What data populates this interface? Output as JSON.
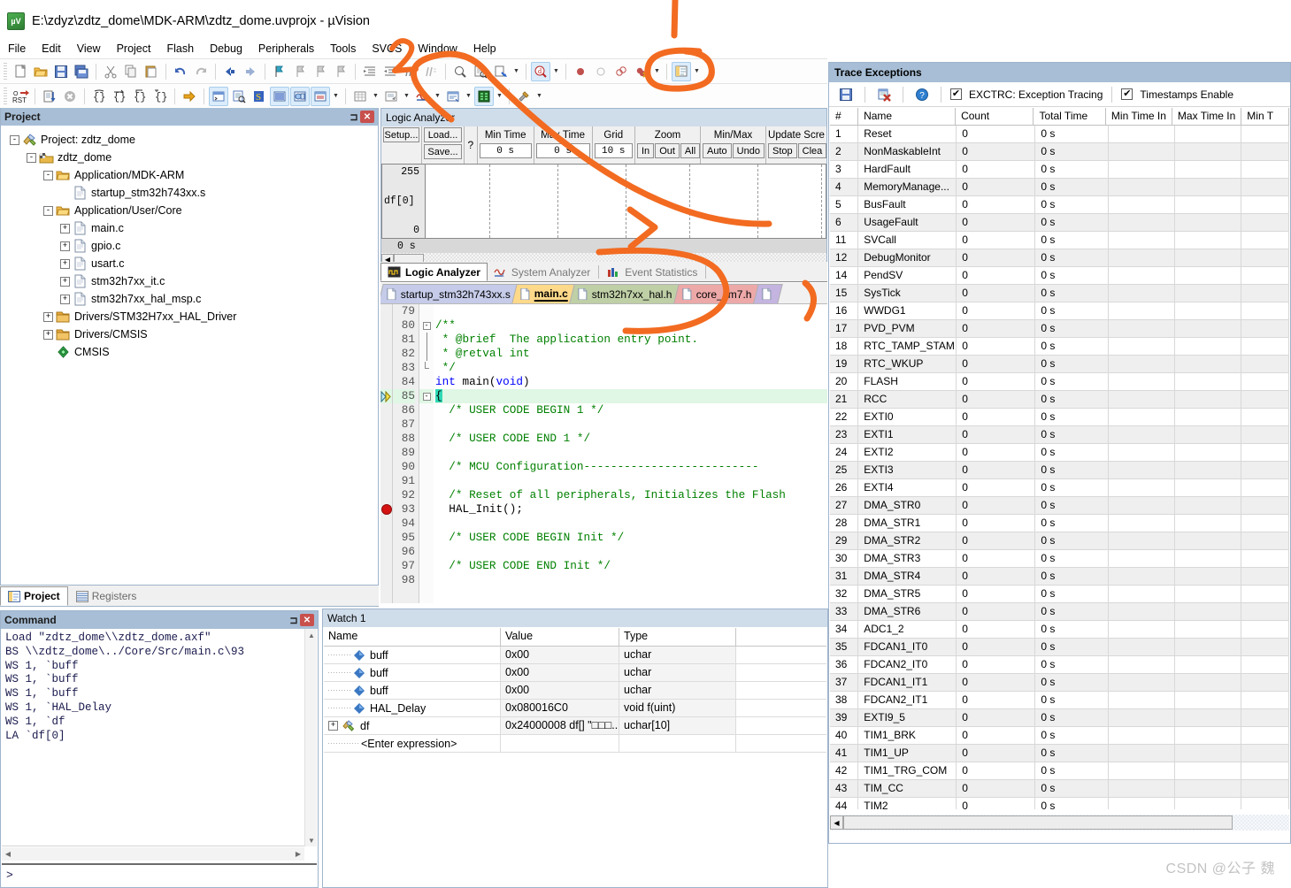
{
  "window": {
    "title": "E:\\zdyz\\zdtz_dome\\MDK-ARM\\zdtz_dome.uvprojx - µVision",
    "app_icon": "uvision-icon"
  },
  "menu": [
    "File",
    "Edit",
    "View",
    "Project",
    "Flash",
    "Debug",
    "Peripherals",
    "Tools",
    "SVCS",
    "Window",
    "Help"
  ],
  "project": {
    "panel_title": "Project",
    "tree": [
      {
        "indent": 0,
        "toggle": "-",
        "icon": "project-icon",
        "label": "Project: zdtz_dome"
      },
      {
        "indent": 1,
        "toggle": "-",
        "icon": "target-icon",
        "label": "zdtz_dome"
      },
      {
        "indent": 2,
        "toggle": "-",
        "icon": "folder-open-icon",
        "label": "Application/MDK-ARM"
      },
      {
        "indent": 3,
        "toggle": "",
        "icon": "file-icon",
        "label": "startup_stm32h743xx.s"
      },
      {
        "indent": 2,
        "toggle": "-",
        "icon": "folder-open-icon",
        "label": "Application/User/Core"
      },
      {
        "indent": 3,
        "toggle": "+",
        "icon": "file-icon",
        "label": "main.c"
      },
      {
        "indent": 3,
        "toggle": "+",
        "icon": "file-icon",
        "label": "gpio.c"
      },
      {
        "indent": 3,
        "toggle": "+",
        "icon": "file-icon",
        "label": "usart.c"
      },
      {
        "indent": 3,
        "toggle": "+",
        "icon": "file-icon",
        "label": "stm32h7xx_it.c"
      },
      {
        "indent": 3,
        "toggle": "+",
        "icon": "file-icon",
        "label": "stm32h7xx_hal_msp.c"
      },
      {
        "indent": 2,
        "toggle": "+",
        "icon": "folder-icon",
        "label": "Drivers/STM32H7xx_HAL_Driver"
      },
      {
        "indent": 2,
        "toggle": "+",
        "icon": "folder-icon",
        "label": "Drivers/CMSIS"
      },
      {
        "indent": 2,
        "toggle": "",
        "icon": "cmsis-icon",
        "label": "CMSIS"
      }
    ],
    "bottom_tabs": [
      {
        "label": "Project",
        "icon": "project-tab-icon",
        "active": true
      },
      {
        "label": "Registers",
        "icon": "registers-tab-icon",
        "active": false
      }
    ]
  },
  "command": {
    "panel_title": "Command",
    "log": "Load \"zdtz_dome\\\\zdtz_dome.axf\"\nBS \\\\zdtz_dome\\../Core/Src/main.c\\93\nWS 1, `buff\nWS 1, `buff\nWS 1, `buff\nWS 1, `HAL_Delay\nWS 1, `df\nLA `df[0]",
    "prompt": ">"
  },
  "logic_analyzer": {
    "panel_title": "Logic Analyzer",
    "buttons": {
      "setup": "Setup...",
      "load": "Load...",
      "save": "Save...",
      "help": "?"
    },
    "fields": [
      {
        "label": "Min Time",
        "value": "0 s"
      },
      {
        "label": "Max Time",
        "value": "0 s"
      },
      {
        "label": "Grid",
        "value": "10 s"
      }
    ],
    "groups": [
      {
        "label": "Zoom",
        "buttons": [
          "In",
          "Out",
          "All"
        ]
      },
      {
        "label": "Min/Max",
        "buttons": [
          "Auto",
          "Undo"
        ]
      },
      {
        "label": "Update Scre",
        "buttons": [
          "Stop",
          "Clea"
        ]
      }
    ],
    "signal": {
      "name": "df[0]",
      "max": "255",
      "min": "0"
    },
    "time_label": "0 s",
    "tabs": [
      {
        "label": "Logic Analyzer",
        "icon": "logic-analyzer-icon",
        "active": true
      },
      {
        "label": "System Analyzer",
        "icon": "system-analyzer-icon",
        "active": false
      },
      {
        "label": "Event Statistics",
        "icon": "event-statistics-icon",
        "active": false
      }
    ]
  },
  "editor": {
    "tabs": [
      {
        "label": "startup_stm32h743xx.s",
        "color": "#c5cbe8",
        "active": false
      },
      {
        "label": "main.c",
        "color": "#ffd98a",
        "active": true
      },
      {
        "label": "stm32h7xx_hal.h",
        "color": "#bfcfa6",
        "active": false
      },
      {
        "label": "core_cm7.h",
        "color": "#eda8a8",
        "active": false
      },
      {
        "label": "",
        "color": "#c4b4e0",
        "active": false
      }
    ],
    "lines": [
      {
        "num": "79",
        "text": "",
        "kind": "plain",
        "fold": "",
        "mark": "",
        "hl": false
      },
      {
        "num": "80",
        "text": "/**",
        "kind": "cmt",
        "fold": "-",
        "mark": "",
        "hl": false
      },
      {
        "num": "81",
        "text": " * @brief  The application entry point.",
        "kind": "cmt",
        "fold": "|",
        "mark": "",
        "hl": false
      },
      {
        "num": "82",
        "text": " * @retval int",
        "kind": "cmt",
        "fold": "|",
        "mark": "",
        "hl": false
      },
      {
        "num": "83",
        "text": " */",
        "kind": "cmt",
        "fold": "L",
        "mark": "",
        "hl": false
      },
      {
        "num": "84",
        "text": "int main(void)",
        "kind": "sig",
        "fold": "",
        "mark": "",
        "hl": false
      },
      {
        "num": "85",
        "text": "{",
        "kind": "plain",
        "fold": "-",
        "mark": "arrow",
        "hl": true
      },
      {
        "num": "86",
        "text": "  /* USER CODE BEGIN 1 */",
        "kind": "cmt",
        "fold": "",
        "mark": "",
        "hl": false
      },
      {
        "num": "87",
        "text": "",
        "kind": "plain",
        "fold": "",
        "mark": "",
        "hl": false
      },
      {
        "num": "88",
        "text": "  /* USER CODE END 1 */",
        "kind": "cmt",
        "fold": "",
        "mark": "",
        "hl": false
      },
      {
        "num": "89",
        "text": "",
        "kind": "plain",
        "fold": "",
        "mark": "",
        "hl": false
      },
      {
        "num": "90",
        "text": "  /* MCU Configuration--------------------------",
        "kind": "cmt",
        "fold": "",
        "mark": "",
        "hl": false
      },
      {
        "num": "91",
        "text": "",
        "kind": "plain",
        "fold": "",
        "mark": "",
        "hl": false
      },
      {
        "num": "92",
        "text": "  /* Reset of all peripherals, Initializes the Flash",
        "kind": "cmt",
        "fold": "",
        "mark": "",
        "hl": false
      },
      {
        "num": "93",
        "text": "  HAL_Init();",
        "kind": "plain",
        "fold": "",
        "mark": "bp",
        "hl": false
      },
      {
        "num": "94",
        "text": "",
        "kind": "plain",
        "fold": "",
        "mark": "",
        "hl": false
      },
      {
        "num": "95",
        "text": "  /* USER CODE BEGIN Init */",
        "kind": "cmt",
        "fold": "",
        "mark": "",
        "hl": false
      },
      {
        "num": "96",
        "text": "",
        "kind": "plain",
        "fold": "",
        "mark": "",
        "hl": false
      },
      {
        "num": "97",
        "text": "  /* USER CODE END Init */",
        "kind": "cmt",
        "fold": "",
        "mark": "",
        "hl": false
      },
      {
        "num": "98",
        "text": "",
        "kind": "plain",
        "fold": "",
        "mark": "",
        "hl": false
      }
    ]
  },
  "watch": {
    "panel_title": "Watch 1",
    "columns": [
      "Name",
      "Value",
      "Type"
    ],
    "rows": [
      {
        "name": "buff",
        "value": "0x00",
        "type": "uchar",
        "icon": "variable-icon",
        "expandable": false
      },
      {
        "name": "buff",
        "value": "0x00",
        "type": "uchar",
        "icon": "variable-icon",
        "expandable": false
      },
      {
        "name": "buff",
        "value": "0x00",
        "type": "uchar",
        "icon": "variable-icon",
        "expandable": false
      },
      {
        "name": "HAL_Delay",
        "value": "0x080016C0",
        "type": "void f(uint)",
        "icon": "variable-icon",
        "expandable": false
      },
      {
        "name": "df",
        "value": "0x24000008 df[] \"□□□...",
        "type": "uchar[10]",
        "icon": "array-icon",
        "expandable": true
      },
      {
        "name": "<Enter expression>",
        "value": "",
        "type": "",
        "icon": "",
        "expandable": false
      }
    ]
  },
  "trace": {
    "panel_title": "Trace Exceptions",
    "toolbar": {
      "save_icon": "save-icon",
      "clear_icon": "clear-trace-icon",
      "help_icon": "help-icon",
      "exctrc_label": "EXCTRC: Exception Tracing",
      "exctrc_checked": true,
      "timestamps_label": "Timestamps Enable",
      "timestamps_checked": true
    },
    "columns": [
      "#",
      "Name",
      "Count",
      "Total Time",
      "Min Time In",
      "Max Time In",
      "Min T"
    ],
    "rows": [
      {
        "idx": "1",
        "name": "Reset",
        "count": "0",
        "total": "0 s"
      },
      {
        "idx": "2",
        "name": "NonMaskableInt",
        "count": "0",
        "total": "0 s"
      },
      {
        "idx": "3",
        "name": "HardFault",
        "count": "0",
        "total": "0 s"
      },
      {
        "idx": "4",
        "name": "MemoryManage...",
        "count": "0",
        "total": "0 s"
      },
      {
        "idx": "5",
        "name": "BusFault",
        "count": "0",
        "total": "0 s"
      },
      {
        "idx": "6",
        "name": "UsageFault",
        "count": "0",
        "total": "0 s"
      },
      {
        "idx": "11",
        "name": "SVCall",
        "count": "0",
        "total": "0 s"
      },
      {
        "idx": "12",
        "name": "DebugMonitor",
        "count": "0",
        "total": "0 s"
      },
      {
        "idx": "14",
        "name": "PendSV",
        "count": "0",
        "total": "0 s"
      },
      {
        "idx": "15",
        "name": "SysTick",
        "count": "0",
        "total": "0 s"
      },
      {
        "idx": "16",
        "name": "WWDG1",
        "count": "0",
        "total": "0 s"
      },
      {
        "idx": "17",
        "name": "PVD_PVM",
        "count": "0",
        "total": "0 s"
      },
      {
        "idx": "18",
        "name": "RTC_TAMP_STAM...",
        "count": "0",
        "total": "0 s"
      },
      {
        "idx": "19",
        "name": "RTC_WKUP",
        "count": "0",
        "total": "0 s"
      },
      {
        "idx": "20",
        "name": "FLASH",
        "count": "0",
        "total": "0 s"
      },
      {
        "idx": "21",
        "name": "RCC",
        "count": "0",
        "total": "0 s"
      },
      {
        "idx": "22",
        "name": "EXTI0",
        "count": "0",
        "total": "0 s"
      },
      {
        "idx": "23",
        "name": "EXTI1",
        "count": "0",
        "total": "0 s"
      },
      {
        "idx": "24",
        "name": "EXTI2",
        "count": "0",
        "total": "0 s"
      },
      {
        "idx": "25",
        "name": "EXTI3",
        "count": "0",
        "total": "0 s"
      },
      {
        "idx": "26",
        "name": "EXTI4",
        "count": "0",
        "total": "0 s"
      },
      {
        "idx": "27",
        "name": "DMA_STR0",
        "count": "0",
        "total": "0 s"
      },
      {
        "idx": "28",
        "name": "DMA_STR1",
        "count": "0",
        "total": "0 s"
      },
      {
        "idx": "29",
        "name": "DMA_STR2",
        "count": "0",
        "total": "0 s"
      },
      {
        "idx": "30",
        "name": "DMA_STR3",
        "count": "0",
        "total": "0 s"
      },
      {
        "idx": "31",
        "name": "DMA_STR4",
        "count": "0",
        "total": "0 s"
      },
      {
        "idx": "32",
        "name": "DMA_STR5",
        "count": "0",
        "total": "0 s"
      },
      {
        "idx": "33",
        "name": "DMA_STR6",
        "count": "0",
        "total": "0 s"
      },
      {
        "idx": "34",
        "name": "ADC1_2",
        "count": "0",
        "total": "0 s"
      },
      {
        "idx": "35",
        "name": "FDCAN1_IT0",
        "count": "0",
        "total": "0 s"
      },
      {
        "idx": "36",
        "name": "FDCAN2_IT0",
        "count": "0",
        "total": "0 s"
      },
      {
        "idx": "37",
        "name": "FDCAN1_IT1",
        "count": "0",
        "total": "0 s"
      },
      {
        "idx": "38",
        "name": "FDCAN2_IT1",
        "count": "0",
        "total": "0 s"
      },
      {
        "idx": "39",
        "name": "EXTI9_5",
        "count": "0",
        "total": "0 s"
      },
      {
        "idx": "40",
        "name": "TIM1_BRK",
        "count": "0",
        "total": "0 s"
      },
      {
        "idx": "41",
        "name": "TIM1_UP",
        "count": "0",
        "total": "0 s"
      },
      {
        "idx": "42",
        "name": "TIM1_TRG_COM",
        "count": "0",
        "total": "0 s"
      },
      {
        "idx": "43",
        "name": "TIM_CC",
        "count": "0",
        "total": "0 s"
      },
      {
        "idx": "44",
        "name": "TIM2",
        "count": "0",
        "total": "0 s"
      }
    ]
  },
  "annotations": {
    "color": "#f26b21",
    "marks": [
      "stroke-2",
      "circle-highlight",
      "long-arrow",
      "curve-bracket",
      "vertical-line"
    ]
  },
  "watermark": "CSDN @公子 魏"
}
